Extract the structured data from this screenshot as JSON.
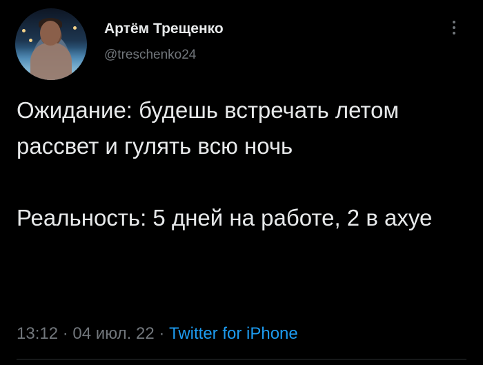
{
  "author": {
    "name": "Артём Трещенко",
    "handle": "@treschenko24",
    "avatar_icon": "avatar-photo-icon"
  },
  "tweet": {
    "paragraph_1": "Ожидание: будешь встречать летом рассвет и гулять всю ночь",
    "paragraph_2": "Реальность: 5 дней на работе, 2 в ахуе"
  },
  "meta": {
    "time": "13:12",
    "separator_1": " · ",
    "date": "04 июл. 22",
    "separator_2": " · ",
    "source": "Twitter for iPhone"
  },
  "menu_icon": "more-vertical-icon",
  "colors": {
    "background": "#000000",
    "text": "#e7e9ea",
    "secondary": "#71767b",
    "link": "#1d9bf0"
  }
}
